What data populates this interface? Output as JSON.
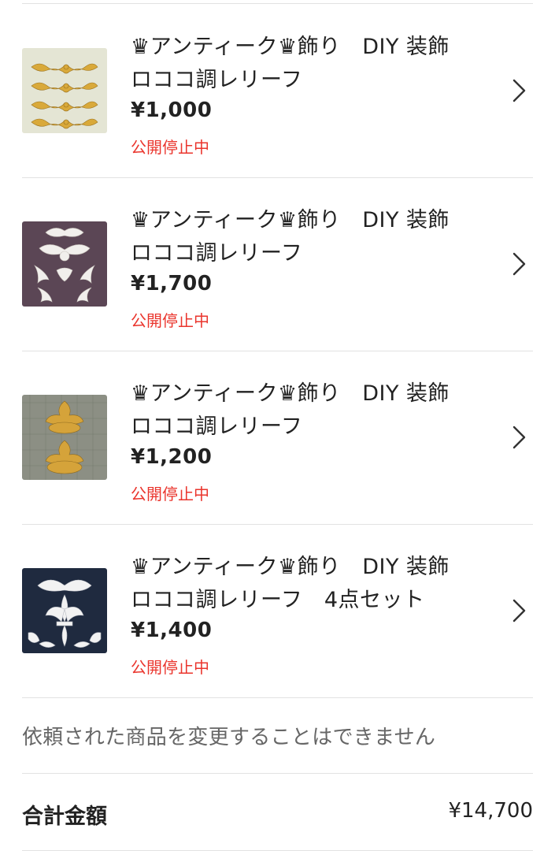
{
  "items": [
    {
      "title": "♛アンティーク♛飾り　DIY 装飾\nロココ調レリーフ",
      "price": "¥1,000",
      "status": "公開停止中",
      "thumb_icon": "gold-scroll-ornaments-thumbnail",
      "thumb_colors": {
        "bg": "#e9e6d6",
        "ornament": "#d9a93a"
      }
    },
    {
      "title": "♛アンティーク♛飾り　DIY 装飾\nロココ調レリーフ",
      "price": "¥1,700",
      "status": "公開停止中",
      "thumb_icon": "white-ornament-set-thumbnail",
      "thumb_colors": {
        "bg": "#5b4655",
        "ornament": "#f1efec"
      }
    },
    {
      "title": "♛アンティーク♛飾り　DIY 装飾\nロココ調レリーフ",
      "price": "¥1,200",
      "status": "公開停止中",
      "thumb_icon": "gold-cartouche-thumbnail",
      "thumb_colors": {
        "bg": "#8c8f84",
        "ornament": "#d5a33a"
      }
    },
    {
      "title": "♛アンティーク♛飾り　DIY 装飾\nロココ調レリーフ　4点セット",
      "price": "¥1,400",
      "status": "公開停止中",
      "thumb_icon": "fleur-de-lis-set-thumbnail",
      "thumb_colors": {
        "bg": "#1f2a3f",
        "ornament": "#f2f2f2"
      }
    }
  ],
  "notice": "依頼された商品を変更することはできません",
  "total": {
    "label": "合計金額",
    "value": "¥14,700"
  },
  "colors": {
    "status_red": "#ea352d",
    "divider": "#e2e2e2",
    "text": "#222222",
    "muted": "#666666"
  }
}
